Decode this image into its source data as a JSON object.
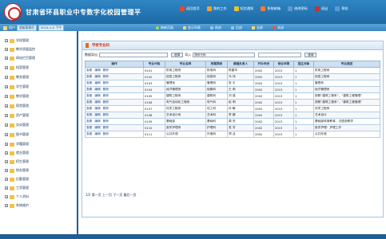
{
  "header": {
    "title": "甘肃省环县职业中专数字化校园管理平",
    "nav": [
      {
        "label": "返回首页",
        "color": "#e04b2c"
      },
      {
        "label": "我的工作",
        "color": "#f0a030"
      },
      {
        "label": "短信通知",
        "color": "#e8c52a"
      },
      {
        "label": "系统邮箱",
        "color": "#f07d30"
      },
      {
        "label": "修改密码",
        "color": "#5a9bd6"
      },
      {
        "label": "退出",
        "color": "#c9302c"
      },
      {
        "label": "帮助",
        "color": "#5a9bd6"
      }
    ]
  },
  "toolbar": {
    "user_label": "用户",
    "user_value": "超级管理员",
    "time_value": "2014-1-5 下午",
    "items": [
      "刷新页面",
      "显示列表",
      "前进",
      "后退",
      "全屏",
      "关闭"
    ]
  },
  "sidebar": {
    "items": [
      "学校管理",
      "教学质量监控",
      "网站栏目管理",
      "档案管理",
      "教务管理",
      "学生管理",
      "教学管理",
      "宿舍管理",
      "资产管理",
      "实训管理",
      "图书管理",
      "学籍管理",
      "就业管理",
      "招生管理",
      "财务管理",
      "后勤管理",
      "工资管理",
      "个人资料",
      "系统维护"
    ]
  },
  "panel": {
    "title": "学校专业科",
    "filters": {
      "export_label": "数据导出",
      "export_value": "",
      "select_btn": "选择",
      "import_label": "导入",
      "field_value": "按系代码",
      "query_value": "",
      "query_btn": "查询"
    },
    "columns": [
      "操作",
      "专业代码",
      "专业名称",
      "所属院系",
      "课程负责人",
      "开办年份",
      "修业年限",
      "招生对象",
      "专业描述"
    ],
    "rows": [
      {
        "ops": [
          "查看",
          "编辑",
          "删除"
        ],
        "code": "0101",
        "name": "机电工程系",
        "dept": "机电科",
        "head": "陈建华",
        "year": "2002",
        "len": "2013",
        "target": "1",
        "desc": "机电工程系"
      },
      {
        "ops": [
          "查看",
          "编辑",
          "删除"
        ],
        "code": "0102",
        "name": "信息工程系",
        "dept": "信息科",
        "head": "马 伟",
        "year": "2002",
        "len": "2013",
        "target": "1",
        "desc": "信息工程系"
      },
      {
        "ops": [
          "查看",
          "编辑",
          "删除"
        ],
        "code": "0103",
        "name": "管理系",
        "dept": "管理科",
        "head": "张 平",
        "year": "2002",
        "len": "2013",
        "target": "1",
        "desc": "管理系"
      },
      {
        "ops": [
          "查看",
          "编辑",
          "删除"
        ],
        "code": "0104",
        "name": "经济管理系",
        "dept": "经管科",
        "head": "王 莉",
        "year": "2002",
        "len": "2013",
        "target": "1",
        "desc": "经济管理系"
      },
      {
        "ops": [
          "查看",
          "编辑",
          "删除"
        ],
        "code": "0105",
        "name": "建筑工程系",
        "dept": "建筑科",
        "head": "刘 强",
        "year": "2002",
        "len": "2013",
        "target": "1",
        "desc": "按照“建筑工程系”，“建筑工程管理”"
      },
      {
        "ops": [
          "查看",
          "编辑",
          "删除"
        ],
        "code": "0106",
        "name": "电气自动化工程系",
        "dept": "电气科",
        "head": "赵 明",
        "year": "2002",
        "len": "2013",
        "target": "1",
        "desc": "按照“建筑工程系”，“建筑工程管理”"
      },
      {
        "ops": [
          "查看",
          "编辑",
          "删除"
        ],
        "code": "0107",
        "name": "化学工程系",
        "dept": "化工科",
        "head": "孙 敏",
        "year": "2002",
        "len": "2013",
        "target": "1",
        "desc": "化学工程系"
      },
      {
        "ops": [
          "查看",
          "编辑",
          "删除"
        ],
        "code": "0108",
        "name": "艺术设计系",
        "dept": "艺术科",
        "head": "李 娜",
        "year": "2002",
        "len": "2013",
        "target": "1",
        "desc": "艺术设计"
      },
      {
        "ops": [
          "查看",
          "编辑",
          "删除"
        ],
        "code": "0109",
        "name": "基础部",
        "dept": "基础科",
        "head": "周 杰",
        "year": "2002",
        "len": "2013",
        "target": "1",
        "desc": "基础部体育教育，汉语言教学"
      },
      {
        "ops": [
          "查看",
          "编辑",
          "删除"
        ],
        "code": "0110",
        "name": "医学护理系",
        "dept": "护理科",
        "head": "吴 芳",
        "year": "2002",
        "len": "2013",
        "target": "1",
        "desc": "医学护理：护理工作"
      },
      {
        "ops": [
          "查看",
          "编辑",
          "删除"
        ],
        "code": "0111",
        "name": "公共外语",
        "dept": "外语科",
        "head": "郑 洁",
        "year": "2002",
        "len": "2013",
        "target": "1",
        "desc": "公共外语"
      }
    ],
    "pager": "1/2 第一页 上一页 下一页 最后一页"
  }
}
